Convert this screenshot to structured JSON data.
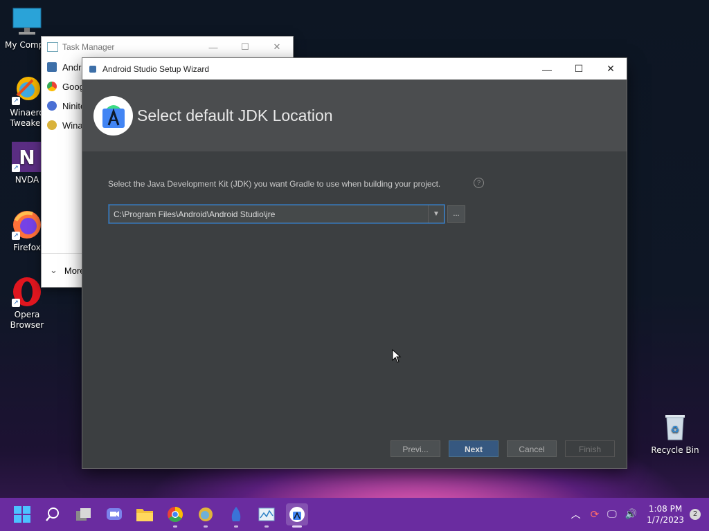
{
  "desktop": {
    "icons": [
      {
        "label": "My Compu",
        "icon": "computer-icon"
      },
      {
        "label": "Winaero Tweaker",
        "icon": "winaero-tweaker-icon"
      },
      {
        "label": "NVDA",
        "icon": "nvda-icon"
      },
      {
        "label": "Firefox",
        "icon": "firefox-icon"
      },
      {
        "label": "Opera Browser",
        "icon": "opera-icon"
      }
    ],
    "recycle_bin": "Recycle Bin"
  },
  "task_manager": {
    "title": "Task Manager",
    "rows": [
      "Andro",
      "Googl",
      "Ninite",
      "Winae"
    ],
    "more_label": "More"
  },
  "wizard": {
    "title": "Android Studio Setup Wizard",
    "header_title": "Select default JDK Location",
    "description": "Select the Java Development Kit (JDK) you want Gradle to use when building your project.",
    "help_glyph": "?",
    "jdk_path": "C:\\Program Files\\Android\\Android Studio\\jre",
    "browse_label": "...",
    "buttons": {
      "previous": "Previ...",
      "next": "Next",
      "cancel": "Cancel",
      "finish": "Finish"
    }
  },
  "taskbar": {
    "apps": [
      "start-icon",
      "search-icon",
      "task-view-icon",
      "chat-icon",
      "file-explorer-icon",
      "chrome-icon",
      "winaero-icon",
      "ninite-icon",
      "task-manager-icon",
      "android-studio-icon"
    ],
    "time": "1:08 PM",
    "date": "1/7/2023",
    "notification_count": "2"
  },
  "colors": {
    "wizard_bg": "#3c3f41",
    "header_bg": "#4b4d4f",
    "primary_button": "#365880",
    "taskbar": "#6a2ca0"
  }
}
